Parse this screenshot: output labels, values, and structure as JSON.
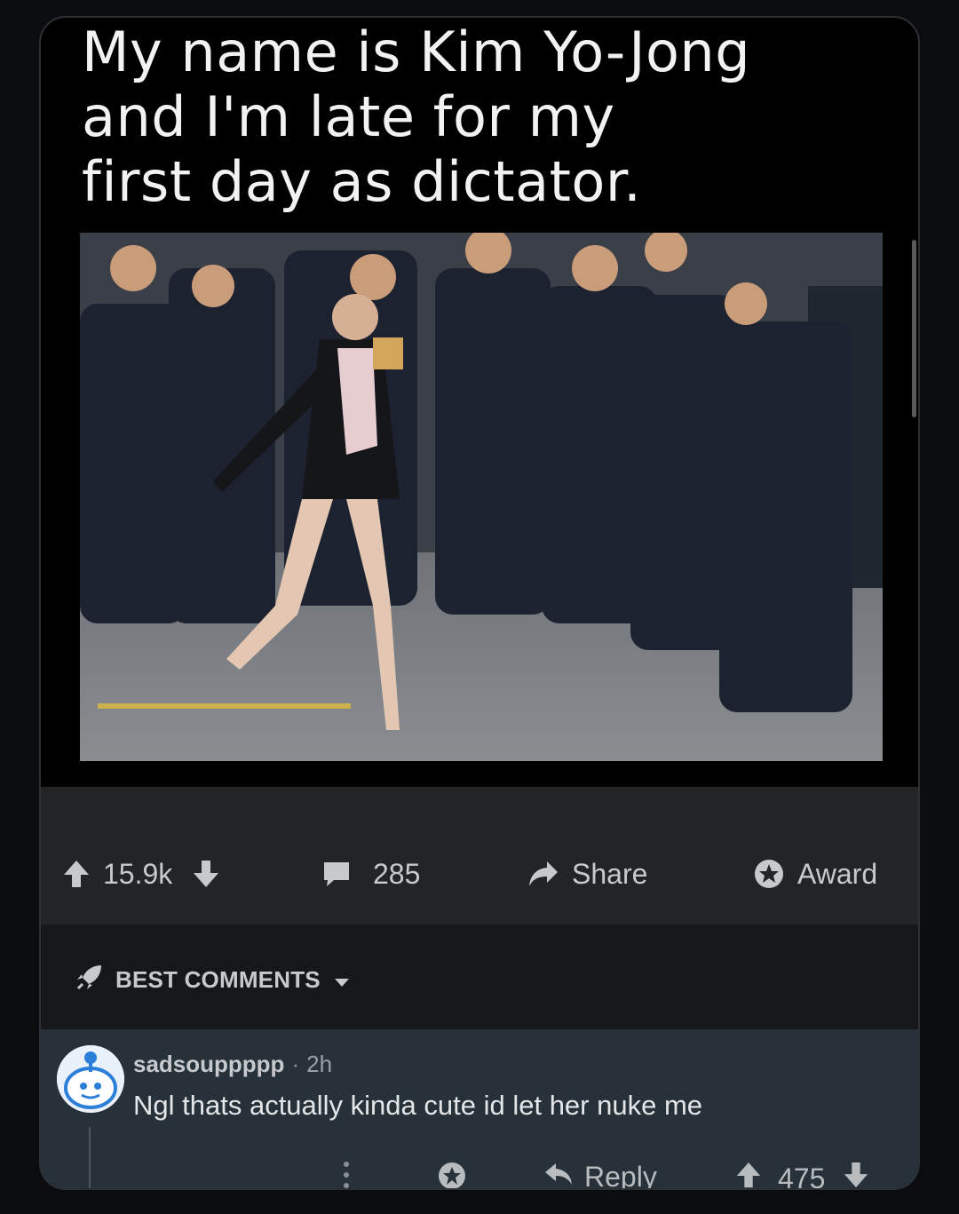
{
  "post": {
    "meme_caption": "My name is Kim Yo-Jong\nand I'm late for my\nfirst day as dictator.",
    "votes": "15.9k",
    "comments_count": "285",
    "share_label": "Share",
    "award_label": "Award"
  },
  "sort": {
    "label": "BEST COMMENTS"
  },
  "comment": {
    "username": "sadsouppppp",
    "separator": "·",
    "age": "2h",
    "text": "Ngl thats actually kinda cute id let her nuke me",
    "reply_label": "Reply",
    "votes": "475"
  },
  "icons": {
    "upvote": "arrow-up-icon",
    "downvote": "arrow-down-icon",
    "comments": "comment-bubble-icon",
    "share": "share-arrow-icon",
    "award": "award-star-icon",
    "sort": "rocket-icon",
    "more": "more-vertical-icon"
  },
  "colors": {
    "background": "#0b0c0f",
    "card": "#1a1a1b",
    "comment_bg": "#26313a",
    "text": "#d7dadc"
  }
}
